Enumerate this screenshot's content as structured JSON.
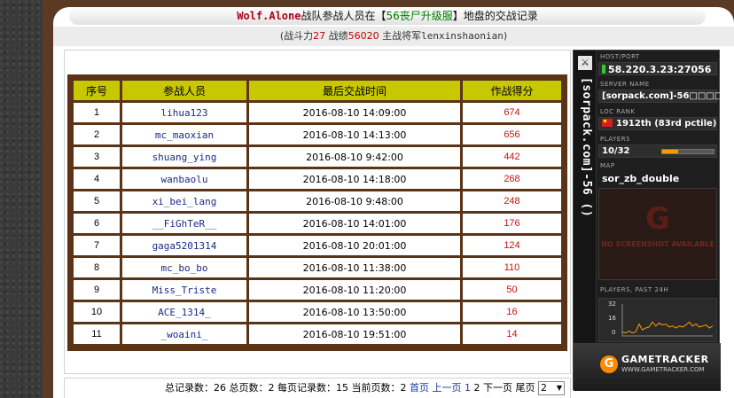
{
  "header": {
    "team_name": "Wolf.Alone",
    "title_part1": "战队参战人员在【",
    "server_name": "56丧尸升级服",
    "title_part2": "】地盘的交战记录"
  },
  "subheader": {
    "power_label": "(战斗力",
    "power_value": "27",
    "record_label": "战绩",
    "record_value": "56020",
    "general_label": "主战将军",
    "general_value": "lenxinshaonian",
    "close_paren": ")"
  },
  "table": {
    "columns": [
      "序号",
      "参战人员",
      "最后交战时间",
      "作战得分"
    ],
    "rows": [
      {
        "idx": "1",
        "player": "lihua123",
        "time": "2016-08-10 14:09:00",
        "score": "674"
      },
      {
        "idx": "2",
        "player": "mc_maoxian",
        "time": "2016-08-10 14:13:00",
        "score": "656"
      },
      {
        "idx": "3",
        "player": "shuang_ying",
        "time": "2016-08-10 9:42:00",
        "score": "442"
      },
      {
        "idx": "4",
        "player": "wanbaolu",
        "time": "2016-08-10 14:18:00",
        "score": "268"
      },
      {
        "idx": "5",
        "player": "xi_bei_lang",
        "time": "2016-08-10 9:48:00",
        "score": "248"
      },
      {
        "idx": "6",
        "player": "__FiGhTeR__",
        "time": "2016-08-10 14:01:00",
        "score": "176"
      },
      {
        "idx": "7",
        "player": "gaga5201314",
        "time": "2016-08-10 20:01:00",
        "score": "124"
      },
      {
        "idx": "8",
        "player": "mc_bo_bo",
        "time": "2016-08-10 11:38:00",
        "score": "110"
      },
      {
        "idx": "9",
        "player": "Miss_Triste",
        "time": "2016-08-10 11:20:00",
        "score": "50"
      },
      {
        "idx": "10",
        "player": "ACE_1314_",
        "time": "2016-08-10 13:50:00",
        "score": "16"
      },
      {
        "idx": "11",
        "player": "_woaini_",
        "time": "2016-08-10 19:51:00",
        "score": "14"
      }
    ]
  },
  "pager": {
    "total_records": "总记录数：26",
    "total_pages": "总页数：2",
    "per_page": "每页记录数：15",
    "current_page": "当前页数：2",
    "first": "首页",
    "prev": "上一页",
    "page1": "1",
    "page2": "2",
    "next": "下一页",
    "last": "尾页",
    "select_value": "2"
  },
  "gametracker": {
    "vertical_title": "[sorpack.com]-56 ()",
    "host_label": "HOST/PORT",
    "host_value": "58.220.3.23:27056",
    "server_label": "SERVER NAME",
    "server_value": "[sorpack.com]-56□□□□",
    "rank_label": "LOC  RANK",
    "rank_value": "1912th (83rd pctile)",
    "players_label": "PLAYERS",
    "players_value": "10/32",
    "players_fill": 0.3125,
    "map_label": "MAP",
    "map_value": "sor_zb_double",
    "no_screenshot": "NO SCREENSHOT AVAILABLE",
    "graph_label": "PLAYERS, PAST 24H",
    "graph_ticks": [
      "32",
      "16",
      "0"
    ],
    "graph_values": [
      4,
      3,
      5,
      3,
      4,
      12,
      6,
      8,
      9,
      14,
      10,
      13,
      11,
      12,
      9,
      10,
      8,
      10,
      9,
      11,
      14,
      10,
      12,
      9,
      10,
      11,
      8,
      10
    ],
    "brand_name": "GAMETRACKER",
    "brand_url": "WWW.GAMETRACKER.COM",
    "colors": {
      "accent": "#ff9900",
      "online": "#33cc33"
    }
  }
}
